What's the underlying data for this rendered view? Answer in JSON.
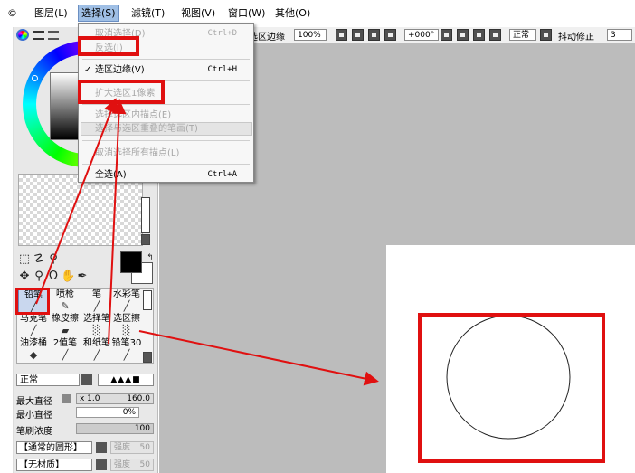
{
  "menubar": {
    "items": [
      "©",
      "图层(L)",
      "选择(S)",
      "滤镜(T)",
      "视图(V)",
      "窗口(W)",
      "其他(O)"
    ]
  },
  "toolbar": {
    "selection_edge_label": "选区边缘",
    "zoom_value": "100%",
    "rotation_value": "+000°",
    "blend_mode": "正常",
    "stabilizer_label": "抖动修正",
    "stabilizer_value": "3"
  },
  "dropdown": {
    "items": [
      {
        "label": "取消选择(D)",
        "shortcut": "Ctrl+D",
        "disabled": true
      },
      {
        "label": "反选(I)",
        "shortcut": "",
        "disabled": true
      },
      {
        "label": "选区边缘(V)",
        "shortcut": "Ctrl+H",
        "disabled": false,
        "checked": true
      },
      {
        "label": "扩大选区1像素",
        "shortcut": "",
        "disabled": true
      },
      {
        "label": "选择选区内描点(E)",
        "shortcut": "",
        "disabled": true
      },
      {
        "label": "选择与选区重叠的笔画(T)",
        "shortcut": "",
        "disabled": true
      },
      {
        "label": "取消选择所有描点(L)",
        "shortcut": "",
        "disabled": true
      },
      {
        "label": "全选(A)",
        "shortcut": "Ctrl+A",
        "disabled": false
      }
    ]
  },
  "brushes": {
    "cells": [
      {
        "name": "铅笔",
        "icon": "╱"
      },
      {
        "name": "喷枪",
        "icon": "✎"
      },
      {
        "name": "笔",
        "icon": "╱"
      },
      {
        "name": "水彩笔",
        "icon": "╱"
      },
      {
        "name": "马克笔",
        "icon": "╱"
      },
      {
        "name": "橡皮擦",
        "icon": "▰"
      },
      {
        "name": "选择笔",
        "icon": "░"
      },
      {
        "name": "选区擦",
        "icon": "░"
      },
      {
        "name": "油漆桶",
        "icon": "◆"
      },
      {
        "name": "2值笔",
        "icon": "╱"
      },
      {
        "name": "和纸笔",
        "icon": "╱"
      },
      {
        "name": "铅笔30",
        "icon": "╱"
      }
    ]
  },
  "brush_props": {
    "mode": "正常",
    "max_diameter_label": "最大直径",
    "max_diameter_multiplier": "x 1.0",
    "max_diameter_value": "160.0",
    "min_diameter_label": "最小直径",
    "min_diameter_value": "0%",
    "density_label": "笔刷浓度",
    "density_value": "100",
    "shape_label": "【通常的圆形】",
    "shape_strength_label": "强度",
    "shape_strength_value": "50",
    "texture_label": "【无材质】",
    "texture_strength_label": "强度",
    "texture_strength_value": "50"
  },
  "colors": {
    "highlight": "#e01010",
    "menu_active_bg": "#9fbfe5",
    "canvas_bg": "#bcbcbc"
  }
}
